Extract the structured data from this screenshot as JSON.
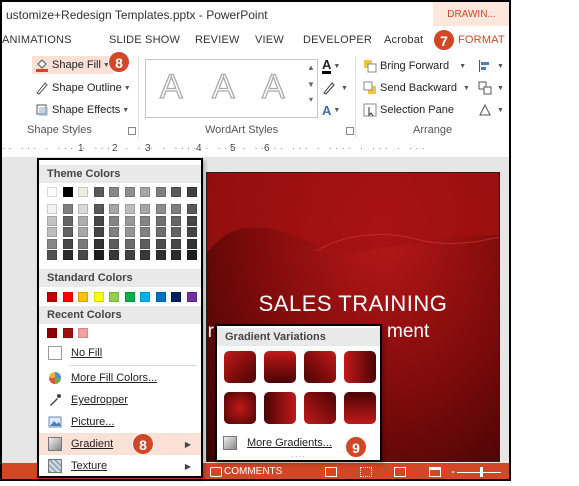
{
  "window": {
    "title": "ustomize+Redesign Templates.pptx - PowerPoint",
    "context_tab_group": "DRAWIN..."
  },
  "tabs": [
    "ANIMATIONS",
    "SLIDE SHOW",
    "REVIEW",
    "VIEW",
    "DEVELOPER",
    "Acrobat",
    "FORMAT"
  ],
  "ribbon": {
    "shape_styles": {
      "shape_fill": "Shape Fill",
      "shape_outline": "Shape Outline",
      "shape_effects": "Shape Effects",
      "label": "Shape Styles"
    },
    "wordart_styles": {
      "sample_letter": "A",
      "label": "WordArt Styles"
    },
    "arrange": {
      "bring_forward": "Bring Forward",
      "send_backward": "Send Backward",
      "selection_pane": "Selection Pane",
      "label": "Arrange"
    }
  },
  "ruler": {
    "marks": [
      "1",
      "2",
      "3",
      "4",
      "5",
      "6"
    ]
  },
  "slide": {
    "title": "SALES TRAINING",
    "subtitle_left": "or",
    "subtitle_right": "ment"
  },
  "fill_menu": {
    "theme_colors_header": "Theme Colors",
    "standard_colors_header": "Standard Colors",
    "recent_colors_header": "Recent Colors",
    "no_fill": "No Fill",
    "more_fill_colors": "More Fill Colors...",
    "eyedropper": "Eyedropper",
    "picture": "Picture...",
    "gradient": "Gradient",
    "texture": "Texture",
    "theme_top_row": [
      "#ffffff",
      "#000000",
      "#eeece1",
      "#595959",
      "#898989",
      "#8c8c8c",
      "#a5a5a5",
      "#7f7f7f",
      "#595959",
      "#404040"
    ],
    "theme_shade_base": [
      "#f2f2f2",
      "#7f7f7f",
      "#d8d8d8",
      "#595959",
      "#a6a6a6",
      "#bfbfbf",
      "#a6a6a6",
      "#8c8c8c",
      "#7f7f7f",
      "#595959"
    ],
    "standard_colors": [
      "#c00000",
      "#ff0000",
      "#ffc000",
      "#ffff00",
      "#92d050",
      "#00b050",
      "#00b0f0",
      "#0070c0",
      "#002060",
      "#7030a0"
    ],
    "recent_colors": [
      "#8b0000",
      "#a01010",
      "#f4a0a0"
    ]
  },
  "gradient_menu": {
    "header": "Gradient Variations",
    "more_gradients": "More Gradients...",
    "gradient_dirs": [
      "135deg",
      "180deg",
      "225deg",
      "90deg",
      "center",
      "270deg",
      "45deg",
      "0deg",
      "315deg"
    ]
  },
  "statusbar": {
    "comments": "COMMENTS"
  },
  "callouts": {
    "seven": "7",
    "eight": "8",
    "nine": "9"
  },
  "colors": {
    "accent": "#d24726",
    "slide_red": "#8b0a0a"
  }
}
